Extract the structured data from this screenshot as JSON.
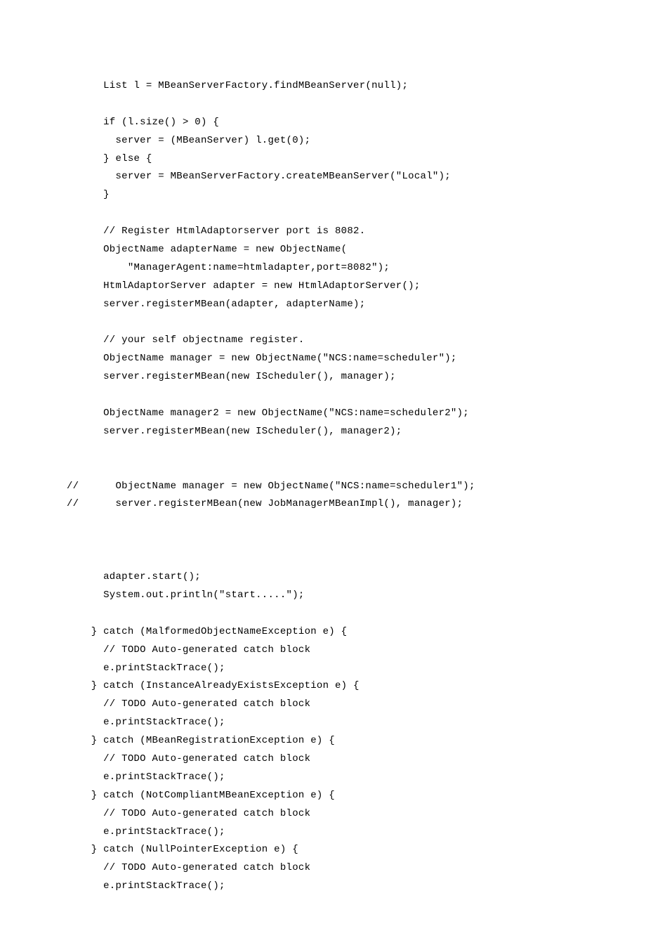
{
  "code": {
    "lines": [
      "      List l = MBeanServerFactory.findMBeanServer(null);",
      "",
      "      if (l.size() > 0) {",
      "        server = (MBeanServer) l.get(0);",
      "      } else {",
      "        server = MBeanServerFactory.createMBeanServer(\"Local\");",
      "      }",
      "",
      "      // Register HtmlAdaptorserver port is 8082.",
      "      ObjectName adapterName = new ObjectName(",
      "          \"ManagerAgent:name=htmladapter,port=8082\");",
      "      HtmlAdaptorServer adapter = new HtmlAdaptorServer();",
      "      server.registerMBean(adapter, adapterName);",
      "",
      "      // your self objectname register.",
      "      ObjectName manager = new ObjectName(\"NCS:name=scheduler\");",
      "      server.registerMBean(new IScheduler(), manager);",
      "",
      "      ObjectName manager2 = new ObjectName(\"NCS:name=scheduler2\");",
      "      server.registerMBean(new IScheduler(), manager2);",
      "",
      "",
      "//      ObjectName manager = new ObjectName(\"NCS:name=scheduler1\");",
      "//      server.registerMBean(new JobManagerMBeanImpl(), manager);",
      "",
      "",
      "",
      "      adapter.start();",
      "      System.out.println(\"start.....\");",
      "",
      "    } catch (MalformedObjectNameException e) {",
      "      // TODO Auto-generated catch block",
      "      e.printStackTrace();",
      "    } catch (InstanceAlreadyExistsException e) {",
      "      // TODO Auto-generated catch block",
      "      e.printStackTrace();",
      "    } catch (MBeanRegistrationException e) {",
      "      // TODO Auto-generated catch block",
      "      e.printStackTrace();",
      "    } catch (NotCompliantMBeanException e) {",
      "      // TODO Auto-generated catch block",
      "      e.printStackTrace();",
      "    } catch (NullPointerException e) {",
      "      // TODO Auto-generated catch block",
      "      e.printStackTrace();"
    ]
  }
}
